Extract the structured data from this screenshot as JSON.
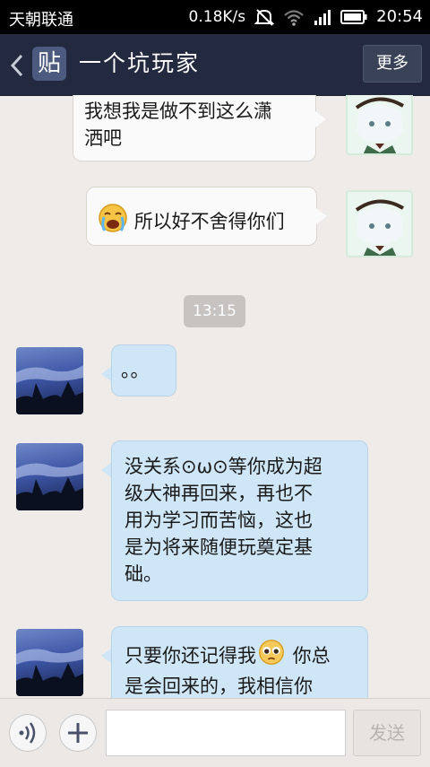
{
  "status_bar": {
    "carrier": "天朝联通",
    "speed": "0.18K/s",
    "time": "20:54",
    "icons": [
      "mute-icon",
      "wifi-icon",
      "signal-icon",
      "battery-icon"
    ]
  },
  "header": {
    "badge_text": "贴",
    "title": "一个坑玩家",
    "more_label": "更多"
  },
  "messages": [
    {
      "side": "right",
      "text_line1": "我想我是做不到这么潇",
      "text_line2": "洒吧",
      "avatar": "anime-avatar"
    },
    {
      "side": "right",
      "text": "所以好不舍得你们",
      "emoji": "crying-emoji",
      "avatar": "anime-avatar"
    },
    {
      "side": "left",
      "text": "。。",
      "avatar": "sky-avatar"
    },
    {
      "side": "left",
      "lines": [
        "没关系⊙ω⊙等你成为超",
        "级大神再回来，再也不",
        "用为学习而苦恼，这也",
        "是为将来随便玩奠定基",
        "础。"
      ],
      "avatar": "sky-avatar"
    },
    {
      "side": "left",
      "line1_prefix": "只要你还记得我",
      "line1_suffix": " 你总",
      "emoji": "pleading-emoji",
      "line2": "是会回来的，我相信你",
      "avatar": "sky-avatar"
    }
  ],
  "timestamp": "13:15",
  "input_bar": {
    "voice_icon": "voice-icon",
    "plus_icon": "plus-icon",
    "input_value": "",
    "send_label": "发送"
  },
  "colors": {
    "title_bg": "#232a40",
    "chat_bg": "#efebe8",
    "bubble_white": "#fafafa",
    "bubble_blue": "#cfe6f6"
  }
}
